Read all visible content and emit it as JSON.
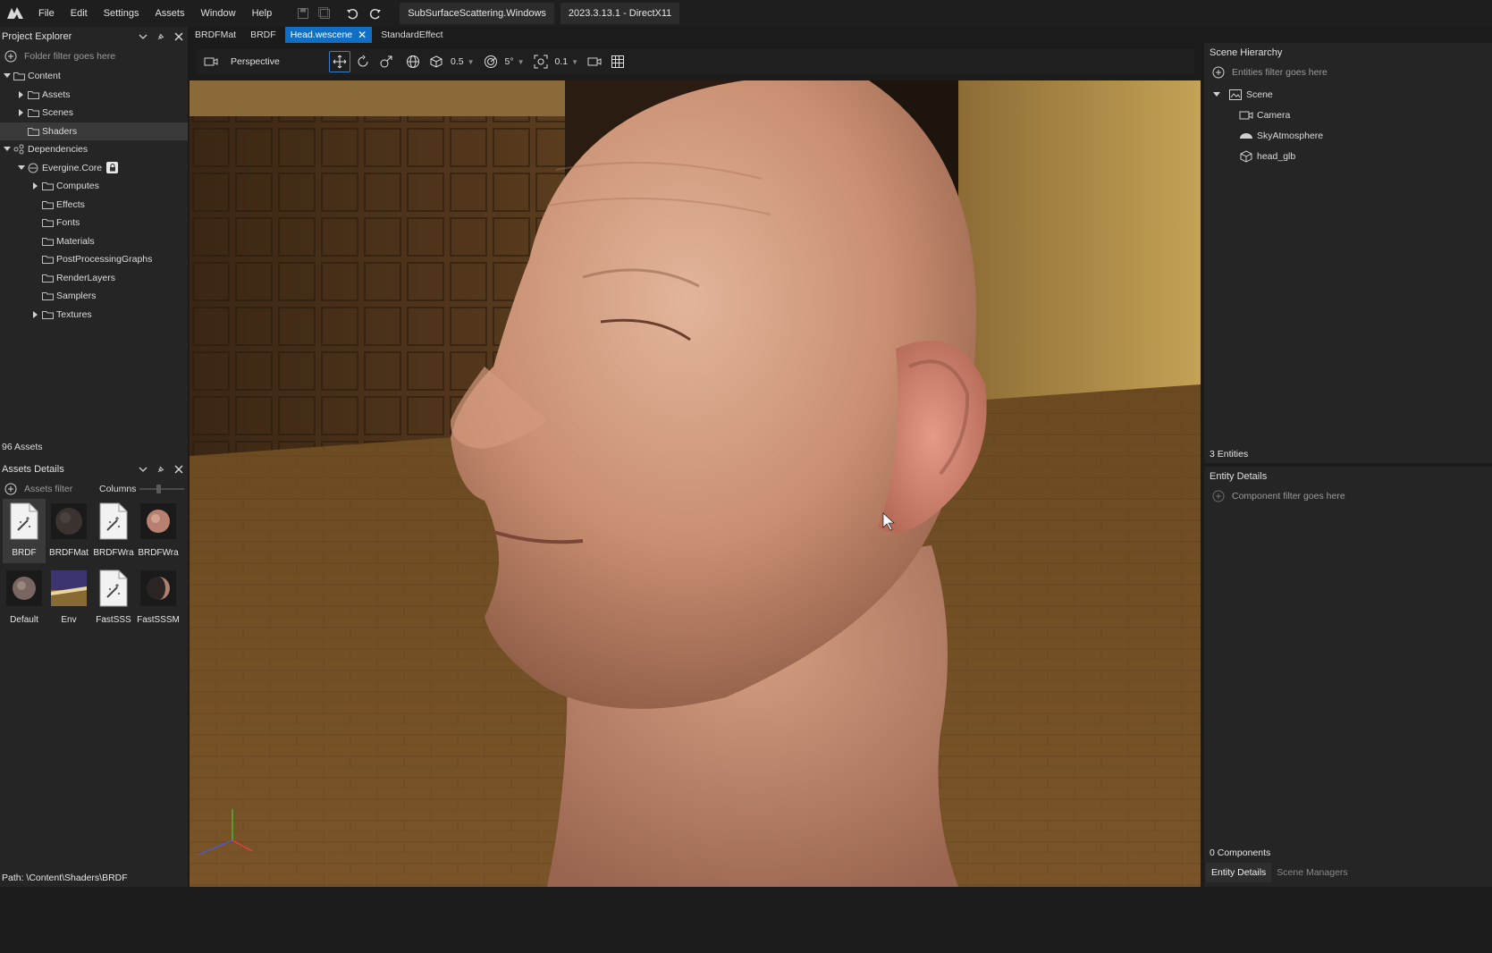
{
  "menu": {
    "items": [
      "File",
      "Edit",
      "Settings",
      "Assets",
      "Window",
      "Help"
    ],
    "project_title": "SubSurfaceScattering.Windows",
    "version": "2023.3.13.1 - DirectX11"
  },
  "project_explorer": {
    "title": "Project Explorer",
    "filter_placeholder": "Folder filter goes here",
    "tree": [
      {
        "label": "Content",
        "depth": 0,
        "expanded": true,
        "caret": true
      },
      {
        "label": "Assets",
        "depth": 1,
        "caret": true
      },
      {
        "label": "Scenes",
        "depth": 1,
        "caret": true
      },
      {
        "label": "Shaders",
        "depth": 1,
        "selected": true
      },
      {
        "label": "Dependencies",
        "depth": 0,
        "expanded": true,
        "caret": true
      },
      {
        "label": "Evergine.Core",
        "depth": 1,
        "expanded": true,
        "caret": true,
        "locked": true
      },
      {
        "label": "Computes",
        "depth": 2,
        "caret": true
      },
      {
        "label": "Effects",
        "depth": 2
      },
      {
        "label": "Fonts",
        "depth": 2
      },
      {
        "label": "Materials",
        "depth": 2
      },
      {
        "label": "PostProcessingGraphs",
        "depth": 2
      },
      {
        "label": "RenderLayers",
        "depth": 2
      },
      {
        "label": "Samplers",
        "depth": 2
      },
      {
        "label": "Textures",
        "depth": 2,
        "caret": true
      }
    ],
    "asset_count": "96 Assets"
  },
  "assets_details": {
    "title": "Assets Details",
    "filter_placeholder": "Assets filter",
    "columns_label": "Columns",
    "items": [
      {
        "name": "BRDF",
        "kind": "effect",
        "selected": true
      },
      {
        "name": "BRDFMat",
        "kind": "material-dark"
      },
      {
        "name": "BRDFWra",
        "kind": "effect"
      },
      {
        "name": "BRDFWra",
        "kind": "material-skin"
      },
      {
        "name": "Default",
        "kind": "material-grey"
      },
      {
        "name": "Env",
        "kind": "texture"
      },
      {
        "name": "FastSSS",
        "kind": "effect"
      },
      {
        "name": "FastSSSM",
        "kind": "material-half"
      }
    ],
    "path": "Path: \\Content\\Shaders\\BRDF"
  },
  "doc_tabs": [
    {
      "label": "BRDFMat"
    },
    {
      "label": "BRDF"
    },
    {
      "label": "Head.wescene",
      "active": true
    },
    {
      "label": "StandardEffect"
    }
  ],
  "viewport_toolbar": {
    "camera_mode": "Perspective",
    "translate_snap": "0.5",
    "rotate_snap": "5°",
    "scale_snap": "0.1"
  },
  "scene_hierarchy": {
    "title": "Scene Hierarchy",
    "filter_placeholder": "Entities filter goes here",
    "items": [
      {
        "label": "Scene",
        "depth": 0,
        "icon": "scene-icon"
      },
      {
        "label": "Camera",
        "depth": 1,
        "icon": "camera-icon"
      },
      {
        "label": "SkyAtmosphere",
        "depth": 1,
        "icon": "sky-icon"
      },
      {
        "label": "head_glb",
        "depth": 1,
        "icon": "cube-icon"
      }
    ],
    "entity_count": "3  Entities"
  },
  "entity_details": {
    "title": "Entity Details",
    "filter_placeholder": "Component filter goes here",
    "component_count": "0 Components",
    "tabs": [
      "Entity Details",
      "Scene Managers"
    ]
  },
  "colors": {
    "accent": "#0f6fc6",
    "panel": "#252526",
    "background": "#1b1b1b"
  }
}
